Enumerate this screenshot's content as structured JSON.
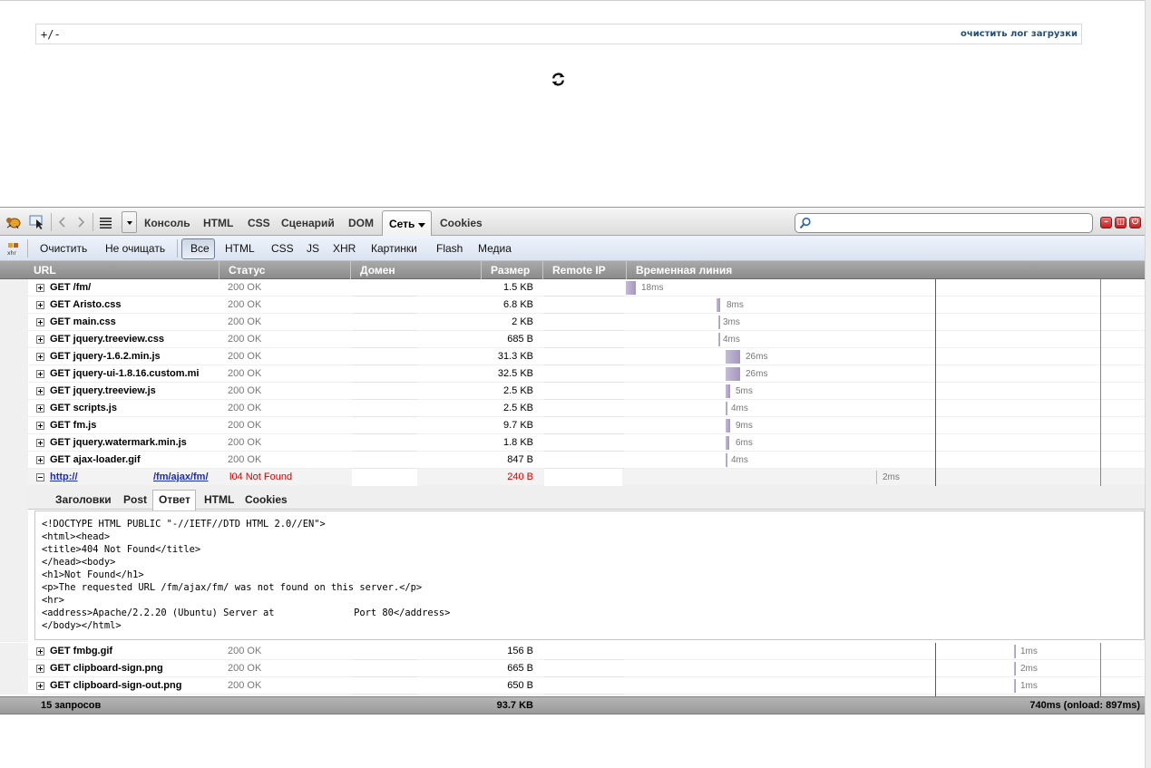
{
  "page": {
    "toggle_label": "+/-",
    "clear_log_label": "очистить лог загрузки",
    "spinner_icon": "refresh-icon"
  },
  "firebug": {
    "main_tabs": [
      "Консоль",
      "HTML",
      "CSS",
      "Сценарий",
      "DOM",
      "Сеть",
      "Cookies"
    ],
    "selected_tab": "Сеть",
    "search_placeholder": "",
    "filters": [
      "Очистить",
      "Не очищать",
      "Все",
      "HTML",
      "CSS",
      "JS",
      "XHR",
      "Картинки",
      "Flash",
      "Медиа"
    ],
    "selected_filter": "Все",
    "columns": [
      "URL",
      "Статус",
      "Домен",
      "Размер",
      "Remote IP",
      "Временная линия"
    ],
    "requests": [
      {
        "url": "GET /fm/",
        "status": "200 OK",
        "size": "1.5 KB",
        "time": "18ms"
      },
      {
        "url": "GET Aristo.css",
        "status": "200 OK",
        "size": "6.8 KB",
        "time": "8ms"
      },
      {
        "url": "GET main.css",
        "status": "200 OK",
        "size": "2 KB",
        "time": "3ms"
      },
      {
        "url": "GET jquery.treeview.css",
        "status": "200 OK",
        "size": "685 B",
        "time": "4ms"
      },
      {
        "url": "GET jquery-1.6.2.min.js",
        "status": "200 OK",
        "size": "31.3 KB",
        "time": "26ms"
      },
      {
        "url": "GET jquery-ui-1.8.16.custom.mi",
        "status": "200 OK",
        "size": "32.5 KB",
        "time": "26ms"
      },
      {
        "url": "GET jquery.treeview.js",
        "status": "200 OK",
        "size": "2.5 KB",
        "time": "5ms"
      },
      {
        "url": "GET scripts.js",
        "status": "200 OK",
        "size": "2.5 KB",
        "time": "4ms"
      },
      {
        "url": "GET fm.js",
        "status": "200 OK",
        "size": "9.7 KB",
        "time": "9ms"
      },
      {
        "url": "GET jquery.watermark.min.js",
        "status": "200 OK",
        "size": "1.8 KB",
        "time": "6ms"
      },
      {
        "url": "GET ajax-loader.gif",
        "status": "200 OK",
        "size": "847 B",
        "time": "4ms"
      }
    ],
    "error_request": {
      "url_a": "http://",
      "url_b": "/fm/ajax/fm/",
      "status": "l04 Not Found",
      "size": "240 B",
      "time": "2ms"
    },
    "response_tabs": [
      "Заголовки",
      "Post",
      "Ответ",
      "HTML",
      "Cookies"
    ],
    "selected_response_tab": "Ответ",
    "response_lines": [
      "<!DOCTYPE HTML PUBLIC \"-//IETF//DTD HTML 2.0//EN\">",
      "<html><head>",
      "<title>404 Not Found</title>",
      "</head><body>",
      "<h1>Not Found</h1>",
      "<p>The requested URL /fm/ajax/fm/ was not found on this server.</p>",
      "<hr>",
      "<address>Apache/2.2.20 (Ubuntu) Server at              Port 80</address>",
      "</body></html>"
    ],
    "later_requests": [
      {
        "url": "GET fmbg.gif",
        "status": "200 OK",
        "size": "156 B",
        "time": "1ms"
      },
      {
        "url": "GET clipboard-sign.png",
        "status": "200 OK",
        "size": "665 B",
        "time": "2ms"
      },
      {
        "url": "GET clipboard-sign-out.png",
        "status": "200 OK",
        "size": "650 B",
        "time": "1ms"
      }
    ],
    "footer": {
      "count": "15 запросов",
      "total_size": "93.7 KB",
      "total_time": "740ms (onload: 897ms)"
    },
    "colors": {
      "dom_line": "#4a4ad6",
      "load_line": "#e06060",
      "error": "#d30000",
      "link": "#1b2db5"
    }
  }
}
